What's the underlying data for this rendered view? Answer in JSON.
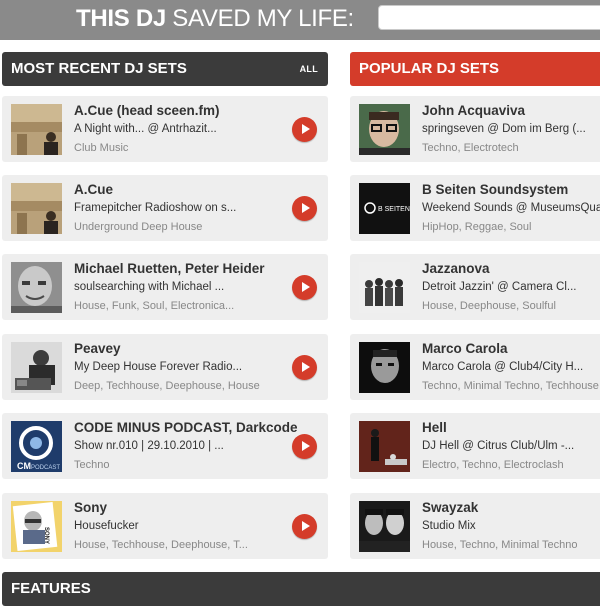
{
  "header": {
    "title_bold": "THIS DJ",
    "title_rest": " SAVED MY LIFE:",
    "input_placeholder": ""
  },
  "recent": {
    "heading": "MOST RECENT DJ SETS",
    "all_link": "ALL",
    "items": [
      {
        "title": "A.Cue (head sceen.fm)",
        "subtitle": "A Night with... @ Antrhazit...",
        "genres": "Club Music"
      },
      {
        "title": "A.Cue",
        "subtitle": "Framepitcher Radioshow on s...",
        "genres": "Underground Deep House"
      },
      {
        "title": "Michael Ruetten, Peter Heider",
        "subtitle": "soulsearching with Michael ...",
        "genres": "House, Funk, Soul, Electronica..."
      },
      {
        "title": "Peavey",
        "subtitle": "My Deep House Forever Radio...",
        "genres": "Deep, Techhouse, Deephouse, House"
      },
      {
        "title": "CODE MINUS PODCAST, Darkcode",
        "subtitle": "Show nr.010 | 29.10.2010 | ...",
        "genres": "Techno"
      },
      {
        "title": "Sony",
        "subtitle": "Housefucker",
        "genres": "House, Techhouse, Deephouse, T..."
      }
    ]
  },
  "popular": {
    "heading": "POPULAR DJ SETS",
    "items": [
      {
        "title": "John Acquaviva",
        "subtitle": "springseven @ Dom im Berg (...",
        "genres": "Techno, Electrotech"
      },
      {
        "title": "B Seiten Soundsystem",
        "subtitle": "Weekend Sounds @ MuseumsQuartier",
        "genres": "HipHop, Reggae, Soul"
      },
      {
        "title": "Jazzanova",
        "subtitle": "Detroit Jazzin' @ Camera Cl...",
        "genres": "House, Deephouse, Soulful"
      },
      {
        "title": "Marco Carola",
        "subtitle": "Marco Carola @ Club4/City H...",
        "genres": "Techno, Minimal Techno, Techhouse"
      },
      {
        "title": "Hell",
        "subtitle": "DJ Hell @ Citrus Club/Ulm -...",
        "genres": "Electro, Techno, Electroclash"
      },
      {
        "title": "Swayzak",
        "subtitle": "Studio Mix",
        "genres": "House, Techno, Minimal Techno"
      }
    ]
  },
  "thumb_text": {
    "b_seiten": "B SEITEN",
    "cm_logo": "CM",
    "cm_sub": "PODCAST",
    "sony_badge": "SONY"
  },
  "features": {
    "heading": "FEATURES"
  },
  "colors": {
    "accent_red": "#d43c2a",
    "header_dark": "#3b3b3b",
    "top_bar_gray": "#8a8a8a",
    "card_bg": "#eeeeee"
  }
}
